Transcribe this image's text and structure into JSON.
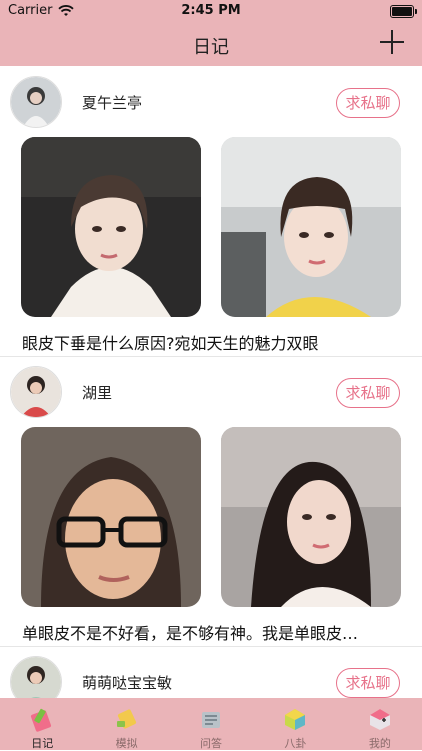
{
  "status": {
    "carrier": "Carrier",
    "time": "2:45 PM"
  },
  "nav": {
    "title": "日记"
  },
  "posts": [
    {
      "username": "夏午兰亭",
      "chat_label": "求私聊",
      "caption": "眼皮下垂是什么原因?宛如天生的魅力双眼"
    },
    {
      "username": "湖里",
      "chat_label": "求私聊",
      "caption": "单眼皮不是不好看，是不够有神。我是单眼皮…"
    },
    {
      "username": "萌萌哒宝宝敏",
      "chat_label": "求私聊",
      "caption": ""
    }
  ],
  "tabs": [
    {
      "label": "日记",
      "icon": "diary-icon"
    },
    {
      "label": "模拟",
      "icon": "simulate-icon"
    },
    {
      "label": "问答",
      "icon": "qa-icon"
    },
    {
      "label": "八卦",
      "icon": "gossip-icon"
    },
    {
      "label": "我的",
      "icon": "profile-icon"
    }
  ],
  "colors": {
    "bar": "#eab4b8",
    "accent": "#e7728a"
  }
}
